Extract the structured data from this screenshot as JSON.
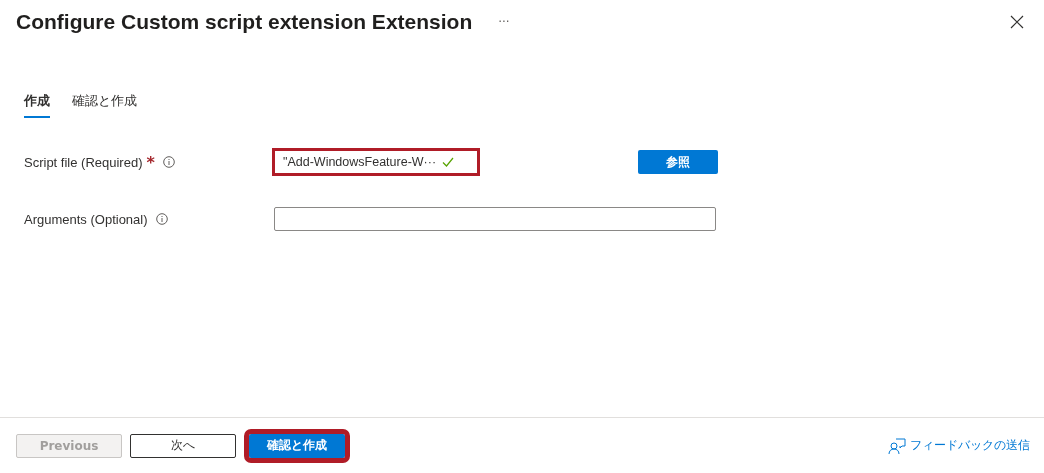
{
  "window": {
    "title": "Configure Custom script extension Extension",
    "more": "···"
  },
  "tabs": [
    {
      "label": "作成",
      "selected": true
    },
    {
      "label": "確認と作成",
      "selected": false
    }
  ],
  "fields": [
    {
      "kind": "file",
      "label": "Script file (Required)",
      "required_mark": "*",
      "value": "\"Add-WindowsFeature-W···",
      "valid": true,
      "highlighted": true,
      "button": "参照"
    },
    {
      "kind": "text",
      "label": "Arguments (Optional)",
      "highlighted": false
    }
  ],
  "footer": {
    "buttons": [
      {
        "label": "Previous",
        "kind": "secondary",
        "disabled": true,
        "highlighted": false
      },
      {
        "label": "次へ",
        "kind": "secondary",
        "disabled": false,
        "highlighted": false
      },
      {
        "label": "確認と作成",
        "kind": "primary",
        "disabled": false,
        "highlighted": true
      }
    ],
    "feedback": "フィードバックの送信"
  }
}
